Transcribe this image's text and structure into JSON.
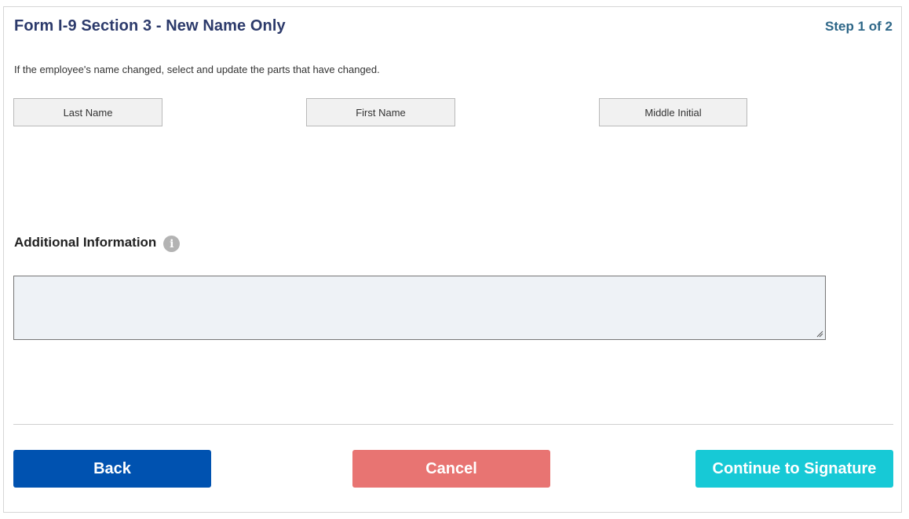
{
  "header": {
    "title": "Form I-9 Section 3 - New Name Only",
    "step": "Step 1 of 2"
  },
  "instructions": "If the employee's name changed, select and update the parts that have changed.",
  "name_parts": {
    "last_name_label": "Last Name",
    "first_name_label": "First Name",
    "middle_initial_label": "Middle Initial"
  },
  "additional_info": {
    "label": "Additional Information",
    "info_icon_glyph": "i",
    "value": ""
  },
  "footer": {
    "back_label": "Back",
    "cancel_label": "Cancel",
    "continue_label": "Continue to Signature"
  },
  "colors": {
    "title": "#2c3a6b",
    "step": "#2e6788",
    "back": "#0052b0",
    "cancel": "#e87472",
    "continue": "#17c9d6",
    "textarea_bg": "#eef2f6"
  },
  "icons": {
    "info": "info-circle-icon",
    "resize": "resize-grip-icon"
  }
}
